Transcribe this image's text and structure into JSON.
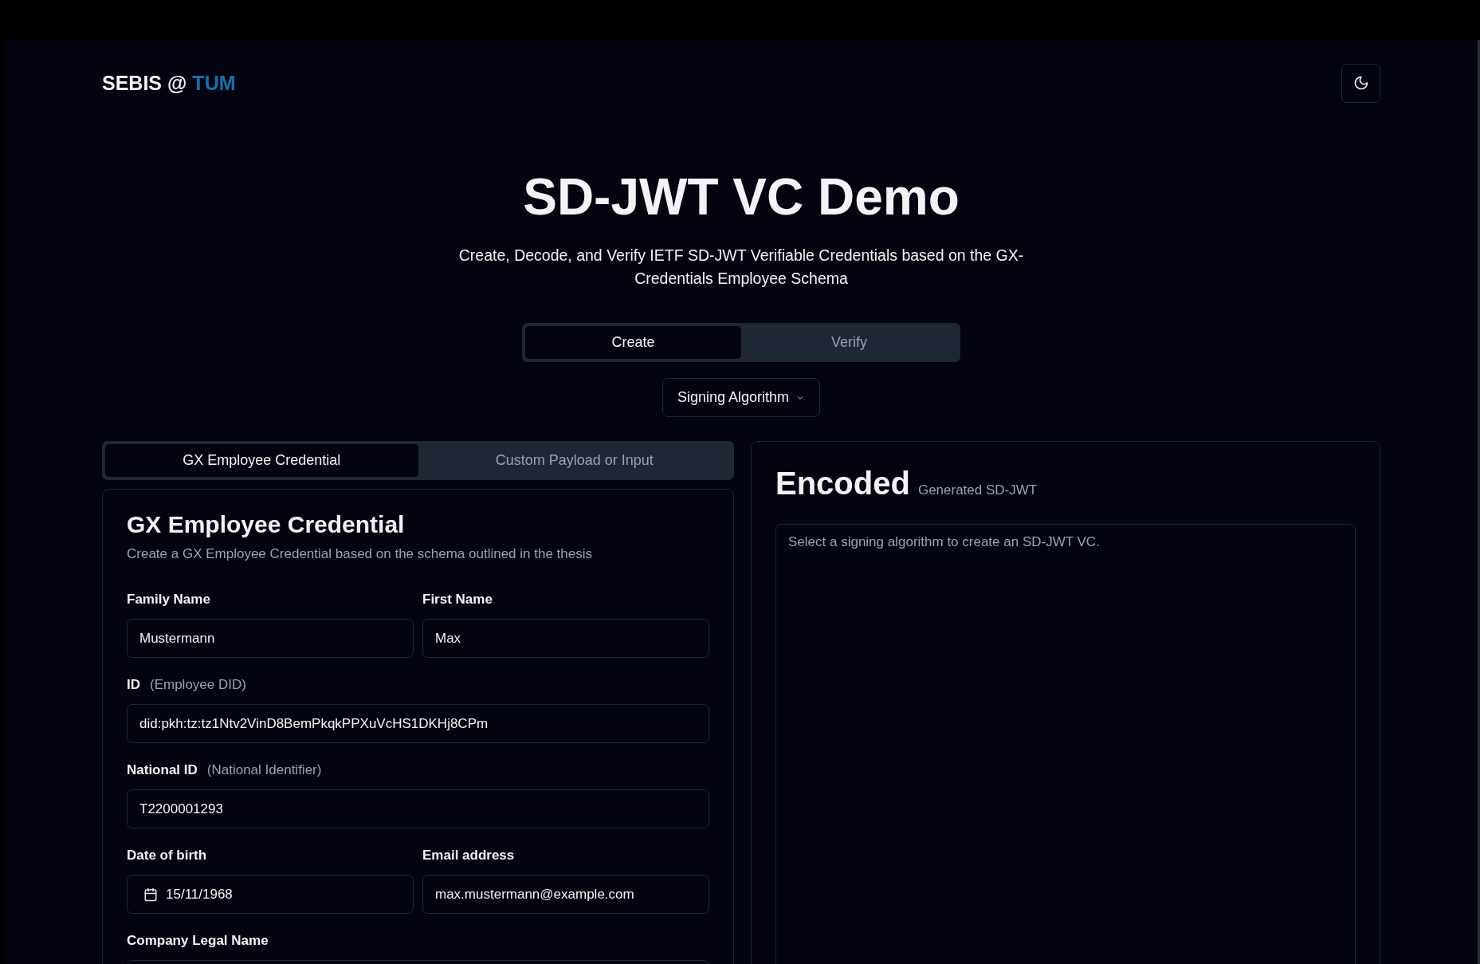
{
  "header": {
    "logo_text": "SEBIS @",
    "logo_accent": "TUM"
  },
  "hero": {
    "title": "SD-JWT VC Demo",
    "subtitle": "Create, Decode, and Verify IETF SD-JWT Verifiable Credentials based on the GX-Credentials Employee Schema"
  },
  "mode_tabs": [
    {
      "label": "Create",
      "selected": true
    },
    {
      "label": "Verify",
      "selected": false
    }
  ],
  "algorithm_dropdown": {
    "label": "Signing Algorithm"
  },
  "credential_tabs": [
    {
      "label": "GX Employee Credential",
      "selected": true
    },
    {
      "label": "Custom Payload or Input",
      "selected": false
    }
  ],
  "form": {
    "title": "GX Employee Credential",
    "description": "Create a GX Employee Credential based on the schema outlined in the thesis",
    "rows": [
      {
        "fields": [
          {
            "label": "Family Name",
            "kind": "text",
            "value": "Mustermann"
          },
          {
            "label": "First Name",
            "kind": "text",
            "value": "Max"
          }
        ]
      },
      {
        "fields": [
          {
            "label": "ID",
            "hint": "(Employee DID)",
            "kind": "text",
            "value": "did:pkh:tz:tz1Ntv2VinD8BemPkqkPPXuVcHS1DKHj8CPm"
          }
        ]
      },
      {
        "fields": [
          {
            "label": "National ID",
            "hint": "(National Identifier)",
            "kind": "text",
            "value": "T2200001293"
          }
        ]
      },
      {
        "fields": [
          {
            "label": "Date of birth",
            "kind": "date",
            "value": "15/11/1968"
          },
          {
            "label": "Email address",
            "kind": "text",
            "value": "max.mustermann@example.com"
          }
        ]
      },
      {
        "fields": [
          {
            "label": "Company Legal Name",
            "kind": "text"
          }
        ]
      }
    ]
  },
  "encoded": {
    "title": "Encoded",
    "subtitle": "Generated SD-JWT",
    "placeholder": "Select a signing algorithm to create an SD-JWT VC."
  }
}
